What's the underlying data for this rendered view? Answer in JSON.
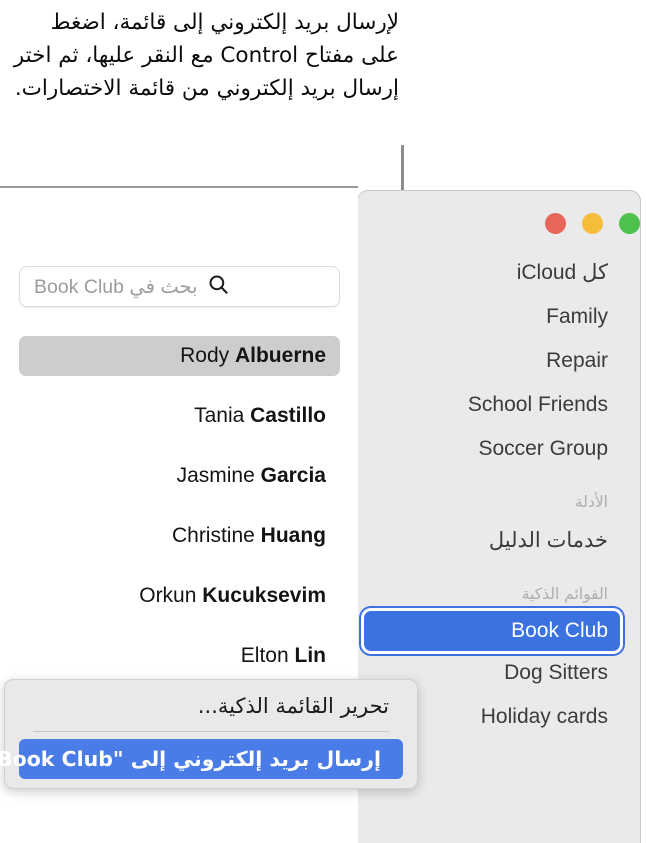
{
  "caption": {
    "text": "لإرسال بريد إلكتروني إلى قائمة، اضغط على مفتاح Control مع النقر عليها، ثم اختر إرسال بريد إلكتروني من قائمة الاختصارات."
  },
  "window": {
    "traffic_lights": [
      {
        "name": "zoom-button",
        "color": "#4cc14c"
      },
      {
        "name": "minimize-button",
        "color": "#f5bd39"
      },
      {
        "name": "close-button",
        "color": "#e8655a"
      }
    ],
    "sidebar": {
      "groups": [
        {
          "header": null,
          "items": [
            {
              "label": "كل iCloud",
              "selected": false
            },
            {
              "label": "Family",
              "selected": false
            },
            {
              "label": "Repair",
              "selected": false
            },
            {
              "label": "School Friends",
              "selected": false
            },
            {
              "label": "Soccer Group",
              "selected": false
            }
          ]
        },
        {
          "header": "الأدلة",
          "items": [
            {
              "label": "خدمات الدليل",
              "selected": false
            }
          ]
        },
        {
          "header": "القوائم الذكية",
          "items": [
            {
              "label": "Book Club",
              "selected": true
            },
            {
              "label": "Dog Sitters",
              "selected": false
            },
            {
              "label": "Holiday cards",
              "selected": false
            }
          ]
        }
      ]
    }
  },
  "left_panel": {
    "search": {
      "placeholder": "بحث في Book Club",
      "value": ""
    },
    "contacts": [
      {
        "first": "Rody ",
        "last": "Albuerne",
        "selected": true
      },
      {
        "first": "Tania ",
        "last": "Castillo",
        "selected": false
      },
      {
        "first": "Jasmine ",
        "last": "Garcia",
        "selected": false
      },
      {
        "first": "Christine ",
        "last": "Huang",
        "selected": false
      },
      {
        "first": "Orkun ",
        "last": "Kucuksevim",
        "selected": false
      },
      {
        "first": "Elton ",
        "last": "Lin",
        "selected": false
      }
    ]
  },
  "context_menu": {
    "items": [
      {
        "label": "تحرير القائمة الذكية...",
        "highlight": false
      },
      {
        "label": "إرسال بريد إلكتروني إلى \"Book Club\"",
        "highlight": true
      }
    ]
  },
  "colors": {
    "accent_blue": "#3c72e0",
    "menu_highlight_blue": "#4a7ce8",
    "selection_gray": "#cdcdcd",
    "window_bg": "#eaeaea"
  }
}
